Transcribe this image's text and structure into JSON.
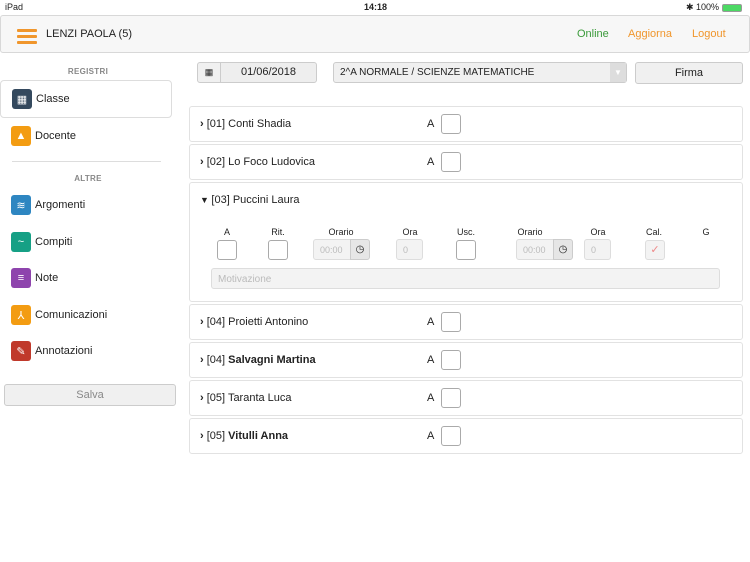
{
  "status": {
    "device": "iPad",
    "time": "14:18",
    "battery": "100%"
  },
  "header": {
    "user": "LENZI PAOLA (5)",
    "online": "Online",
    "refresh": "Aggiorna",
    "logout": "Logout",
    "colors": {
      "online": "#3a9a3a",
      "accent": "#f0962c"
    }
  },
  "sidebar": {
    "registri": "REGISTRI",
    "altre": "ALTRE",
    "items": [
      {
        "label": "Classe",
        "icon": "class-icon",
        "color": "#34495e"
      },
      {
        "label": "Docente",
        "icon": "teacher-icon",
        "color": "#f39c12"
      },
      {
        "label": "Argomenti",
        "icon": "topics-icon",
        "color": "#2e86c1"
      },
      {
        "label": "Compiti",
        "icon": "homework-icon",
        "color": "#16a085"
      },
      {
        "label": "Note",
        "icon": "notes-icon",
        "color": "#8e44ad"
      },
      {
        "label": "Comunicazioni",
        "icon": "pdf-icon",
        "color": "#f39c12"
      },
      {
        "label": "Annotazioni",
        "icon": "annotations-icon",
        "color": "#c0392b"
      }
    ],
    "save": "Salva"
  },
  "toolbar": {
    "date": "01/06/2018",
    "class": "2^A NORMALE / SCIENZE MATEMATICHE",
    "sign": "Firma"
  },
  "students": [
    {
      "name": "[01] Conti Shadia",
      "a": "A",
      "bold": false
    },
    {
      "name": "[02] Lo Foco Ludovica",
      "a": "A",
      "bold": false
    },
    {
      "name": "[03] Puccini Laura",
      "expanded": true
    },
    {
      "name": "[04] Proietti Antonino",
      "a": "A",
      "bold": false
    },
    {
      "prefix": "[04] ",
      "name": "Salvagni Martina",
      "a": "A",
      "bold": true
    },
    {
      "name": "[05] Taranta Luca",
      "a": "A",
      "bold": false
    },
    {
      "prefix": "[05] ",
      "name": "Vitulli Anna",
      "a": "A",
      "bold": true
    }
  ],
  "detail": {
    "h_a": "A",
    "h_rit": "Rit.",
    "h_orario1": "Orario",
    "h_ora1": "Ora",
    "h_usc": "Usc.",
    "h_orario2": "Orario",
    "h_ora2": "Ora",
    "h_cal": "Cal.",
    "h_g": "G",
    "time1": "00:00",
    "hour1": "0",
    "time2": "00:00",
    "hour2": "0",
    "reason_placeholder": "Motivazione"
  }
}
